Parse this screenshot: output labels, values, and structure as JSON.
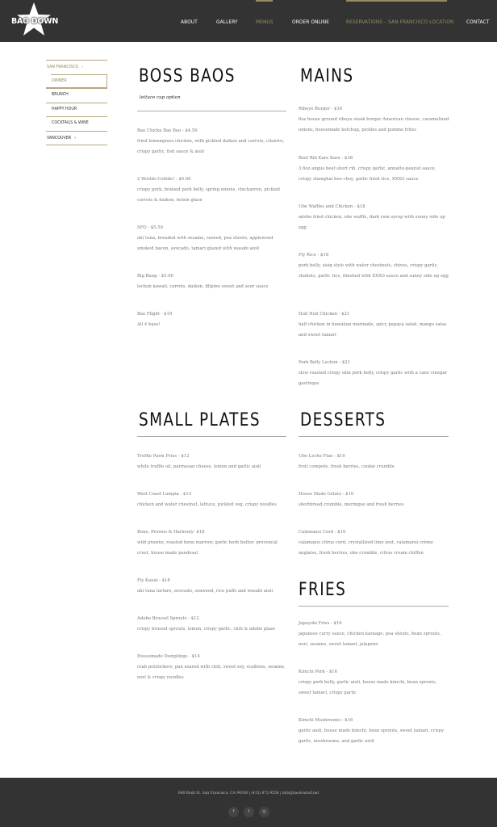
{
  "brand": {
    "name": "BAO DOWN"
  },
  "nav": {
    "items": [
      {
        "label": "ABOUT"
      },
      {
        "label": "GALLERY"
      },
      {
        "label": "MENUS"
      },
      {
        "label": "ORDER ONLINE"
      },
      {
        "label": "RESERVATIONS – SAN FRANCISCO LOCATION"
      },
      {
        "label": "CONTACT"
      }
    ]
  },
  "sidebar": {
    "items": [
      {
        "label": "SAN FRANCISCO"
      },
      {
        "label": "DINNER"
      },
      {
        "label": "BRUNCH"
      },
      {
        "label": "HAPPY HOUR"
      },
      {
        "label": "COCKTAILS & WINE"
      },
      {
        "label": "VANCOUVER"
      }
    ]
  },
  "sections": {
    "boss_baos": {
      "title": "BOSS BAOS",
      "subtitle": "lettuce cup option",
      "items": [
        {
          "name": "Bao Chicka Bao Bao - $4.50",
          "desc": "fried lemongrass chicken, with pickled daikon and carrots, cilantro, crispy garlic, fish sauce & aioli"
        },
        {
          "name": "2 Worlds Collide! - $5.00",
          "desc": "crispy pork, braised pork belly, spring onions, chicharron, pickled carrots & daikon, hoisin glaze"
        },
        {
          "name": "SFO - $5.50",
          "desc": "ahi tuna, breaded with sesame, seared, pea shoots, applewood smoked bacon, avocado, tamari glazed with wasabi aioli"
        },
        {
          "name": "Big Bang - $5.00",
          "desc": "lechon kawali, carrots, daikon, filipino sweet and sour sauce"
        },
        {
          "name": "Bao Flight - $19",
          "desc": "All 4 baos!"
        }
      ]
    },
    "mains": {
      "title": "MAINS",
      "items": [
        {
          "name": "Ribeye Burger - $16",
          "desc": "6oz house ground ribeye steak burger American cheese, caramelized onions, housemade ketchup, pickles and pomme frites"
        },
        {
          "name": "Beef Rib Kare Kare - $38",
          "desc": "3 6oz angus beef short rib, crispy garlic, annatto-peanut sauce, crispy shanghai boo choy, garlic fried rice, XXXO sauce"
        },
        {
          "name": "Ube Waffles and Chicken - $18",
          "desc": "adobo fried chicken, ube waffle, dark rum syrup with sunny side up egg"
        },
        {
          "name": "Fly Rice - $18",
          "desc": "pork belly, sisig style with water chestnuts, chives, crispy garlic, shallots, garlic rice, finished with XXXO sauce and sunny side up egg"
        },
        {
          "name": "Huli Huli Chicken - $21",
          "desc": "half chicken in hawaiian marinade, spicy papaya salad, mango salsa and sweet tamari"
        },
        {
          "name": "Pork Belly Lechon - $21",
          "desc": "slow roasted crispy skin pork belly, crispy garlic with a cane vinegar gastrique"
        }
      ]
    },
    "small_plates": {
      "title": "SMALL PLATES",
      "items": [
        {
          "name": "Truffle Parm Fries - $12",
          "desc": "white truffle oil, parmesan cheese, lemon and garlic aioli"
        },
        {
          "name": "West Coast Lumpia - $15",
          "desc": "chicken and water chestnut, lettuce, pickled veg, crispy noodles"
        },
        {
          "name": "Bone, Prawns & Harmony- $18",
          "desc": "wild prawns, roasted bone marrow, garlic herb butter, provencal crust, house made pandesal"
        },
        {
          "name": "Fly Kauai - $18",
          "desc": "ahi tuna tartare, avocado, seaweed, rice puffs and wasabi aioli"
        },
        {
          "name": "Adobo Brussel Sprouts - $12",
          "desc": "crispy brussel sprouts, lemon, crispy garlic, chili & adobo glaze"
        },
        {
          "name": "Housemade Dumplings - $14",
          "desc": "crab potstickers, pan seared with chili, sweet soy, scallions, sesame, nori & crispy noodles"
        }
      ]
    },
    "desserts": {
      "title": "DESSERTS",
      "items": [
        {
          "name": "Ube Leche Flan - $10",
          "desc": "fruit compote, fresh berries, cookie crumble"
        },
        {
          "name": "House Made Gelato - $10",
          "desc": "shortbread crumble, meringue and fresh berries"
        },
        {
          "name": "Calamansi Curd - $10",
          "desc": "calamansi citrus curd, crystallized lime zest, calamansi crème anglaise, fresh berries, ube crumble, citrus cream chiffon"
        }
      ]
    },
    "fries": {
      "title": "FRIES",
      "items": [
        {
          "name": "Japayoki Fries - $16",
          "desc": "japanese curry sauce, chicken karaage, pea shoots, bean sprouts, nori, sesame, sweet tamari, jalapeno"
        },
        {
          "name": "Kimchi Pork - $16",
          "desc": "crispy pork belly, garlic aioli, house made kimchi, bean sprouts, sweet tamari, crispy garlic"
        },
        {
          "name": "Kimchi Mushrooms - $16",
          "desc": "garlic aioli, house made kimchi, bean sprouts, sweet tamari, crispy garlic, mushrooms, and garlic aioli"
        }
      ]
    }
  },
  "footer": {
    "address": "648 Bush St. San Francisco, CA 94108 | (415) 872-9558 | info@baodownsf.net",
    "social": [
      {
        "icon": "facebook-icon",
        "glyph": "f"
      },
      {
        "icon": "twitter-icon",
        "glyph": "t"
      },
      {
        "icon": "instagram-icon",
        "glyph": "◎"
      }
    ]
  },
  "colors": {
    "header_bg": "#333333",
    "accent": "#9a8a5e",
    "footer_bg": "#333333"
  }
}
